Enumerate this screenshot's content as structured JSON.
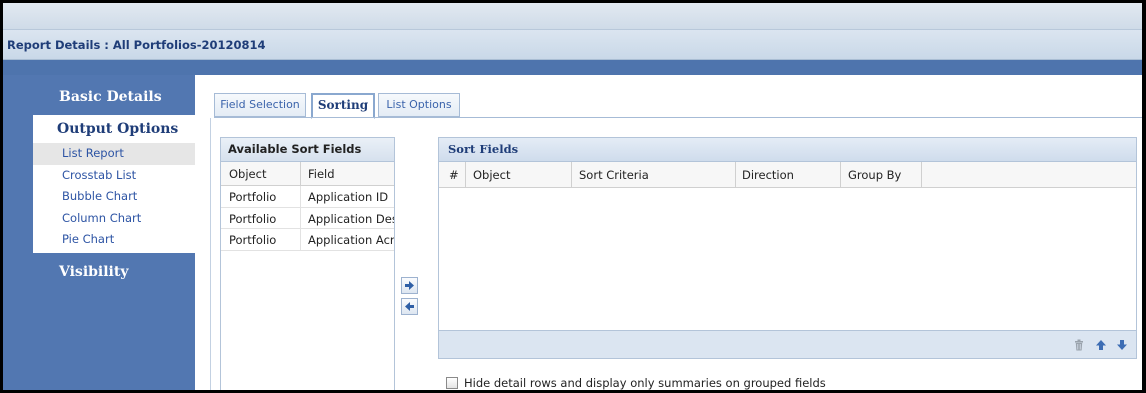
{
  "report": {
    "title": "Report Details : All Portfolios-20120814"
  },
  "sidebar": {
    "basic_details": "Basic Details",
    "output_options": "Output Options",
    "items": [
      {
        "label": "List Report",
        "active": true
      },
      {
        "label": "Crosstab List",
        "active": false
      },
      {
        "label": "Bubble Chart",
        "active": false
      },
      {
        "label": "Column Chart",
        "active": false
      },
      {
        "label": "Pie Chart",
        "active": false
      }
    ],
    "visibility": "Visibility"
  },
  "tabs": [
    {
      "label": "Field Selection",
      "active": false
    },
    {
      "label": "Sorting",
      "active": true
    },
    {
      "label": "List Options",
      "active": false
    }
  ],
  "available": {
    "title": "Available Sort Fields",
    "columns": [
      "Object",
      "Field"
    ],
    "rows": [
      [
        "Portfolio",
        "Application ID"
      ],
      [
        "Portfolio",
        "Application Desc"
      ],
      [
        "Portfolio",
        "Application Acro"
      ]
    ]
  },
  "sort_fields": {
    "title": "Sort Fields",
    "columns": [
      "#",
      "Object",
      "Sort Criteria",
      "Direction",
      "Group By"
    ]
  },
  "icons": {
    "move_right": "arrow-right-icon",
    "move_left": "arrow-left-icon",
    "delete": "trash-icon",
    "up": "arrow-up-icon",
    "down": "arrow-down-icon"
  },
  "options": {
    "hide_detail_label": "Hide detail rows and display only summaries on grouped fields",
    "hide_detail_checked": false
  },
  "colors": {
    "sidebar": "#5277b1",
    "accent": "#1f3d78",
    "link": "#2d54a4"
  }
}
